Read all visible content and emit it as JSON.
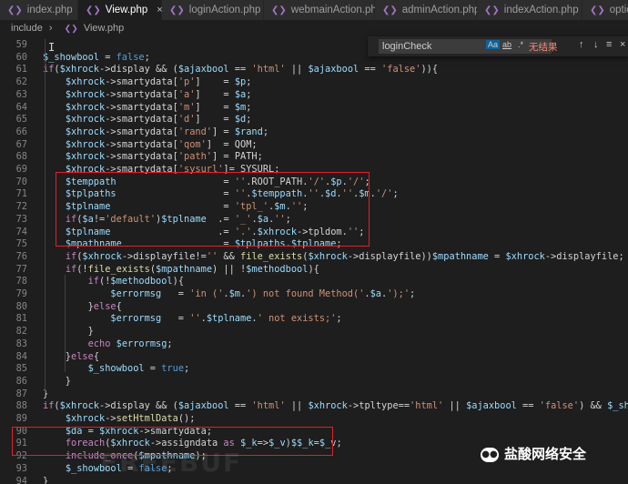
{
  "tabs": [
    {
      "label": "index.php",
      "active": false
    },
    {
      "label": "View.php",
      "active": true
    },
    {
      "label": "loginAction.php",
      "active": false
    },
    {
      "label": "webmainAction.php",
      "active": false
    },
    {
      "label": "adminAction.php",
      "active": false
    },
    {
      "label": "indexAction.php",
      "active": false
    },
    {
      "label": "optionMo",
      "active": false
    }
  ],
  "breadcrumb": {
    "folder": "include",
    "file": "View.php"
  },
  "find": {
    "value": "loginCheck",
    "match_case": "Aa",
    "whole_word": "ab",
    "regex": ".*",
    "no_results": "无结果"
  },
  "watermark": {
    "text": "盐酸网络安全",
    "faint": "FREEBUF"
  },
  "colors": {
    "highlight_box": "#e0202a",
    "editor_bg": "#1e1e1e"
  },
  "lines": [
    {
      "num": "59",
      "text": ""
    },
    {
      "num": "60",
      "text": "$_showbool = false;"
    },
    {
      "num": "61",
      "text": "if($xhrock->display && ($ajaxbool == 'html' || $ajaxbool == 'false')){"
    },
    {
      "num": "62",
      "text": "    $xhrock->smartydata['p']    = $p;"
    },
    {
      "num": "63",
      "text": "    $xhrock->smartydata['a']    = $a;"
    },
    {
      "num": "64",
      "text": "    $xhrock->smartydata['m']    = $m;"
    },
    {
      "num": "65",
      "text": "    $xhrock->smartydata['d']    = $d;"
    },
    {
      "num": "66",
      "text": "    $xhrock->smartydata['rand'] = $rand;"
    },
    {
      "num": "67",
      "text": "    $xhrock->smartydata['qom']  = QOM;"
    },
    {
      "num": "68",
      "text": "    $xhrock->smartydata['path'] = PATH;"
    },
    {
      "num": "69",
      "text": "    $xhrock->smartydata['sysurl']= SYSURL;"
    },
    {
      "num": "70",
      "text": "    $temppath                   = ''.ROOT_PATH.'/'.$p.'/';"
    },
    {
      "num": "71",
      "text": "    $tplpaths                   = ''.$temppath.''.$d.''.$m.'/';"
    },
    {
      "num": "72",
      "text": "    $tplname                    = 'tpl_'.$m.'';"
    },
    {
      "num": "73",
      "text": "    if($a!='default')$tplname  .= '_'.$a.'';"
    },
    {
      "num": "74",
      "text": "    $tplname                   .= '.'.$xhrock->tpldom.'';"
    },
    {
      "num": "75",
      "text": "    $mpathname                  = $tplpaths.$tplname;"
    },
    {
      "num": "76",
      "text": "    if($xhrock->displayfile!='' && file_exists($xhrock->displayfile))$mpathname = $xhrock->displayfile;"
    },
    {
      "num": "77",
      "text": "    if(!file_exists($mpathname) || !$methodbool){"
    },
    {
      "num": "78",
      "text": "        if(!$methodbool){"
    },
    {
      "num": "79",
      "text": "            $errormsg   = 'in ('.$m.') not found Method('.$a.');';"
    },
    {
      "num": "80",
      "text": "        }else{"
    },
    {
      "num": "81",
      "text": "            $errormsg   = ''.$tplname.' not exists;';"
    },
    {
      "num": "82",
      "text": "        }"
    },
    {
      "num": "83",
      "text": "        echo $errormsg;"
    },
    {
      "num": "84",
      "text": "    }else{"
    },
    {
      "num": "85",
      "text": "        $_showbool = true;"
    },
    {
      "num": "86",
      "text": "    }"
    },
    {
      "num": "87",
      "text": "}"
    },
    {
      "num": "88",
      "text": "if($xhrock->display && ($ajaxbool == 'html' || $xhrock->tpltype=='html' || $ajaxbool == 'false') && $_showbool){"
    },
    {
      "num": "89",
      "text": "    $xhrock->setHtmlData();"
    },
    {
      "num": "90",
      "text": "    $da = $xhrock->smartydata;"
    },
    {
      "num": "91",
      "text": "    foreach($xhrock->assigndata as $_k=>$_v)$$_k=$_v;"
    },
    {
      "num": "92",
      "text": "    include_once($mpathname);"
    },
    {
      "num": "93",
      "text": "    $_showbool = false;"
    },
    {
      "num": "94",
      "text": "}"
    }
  ]
}
